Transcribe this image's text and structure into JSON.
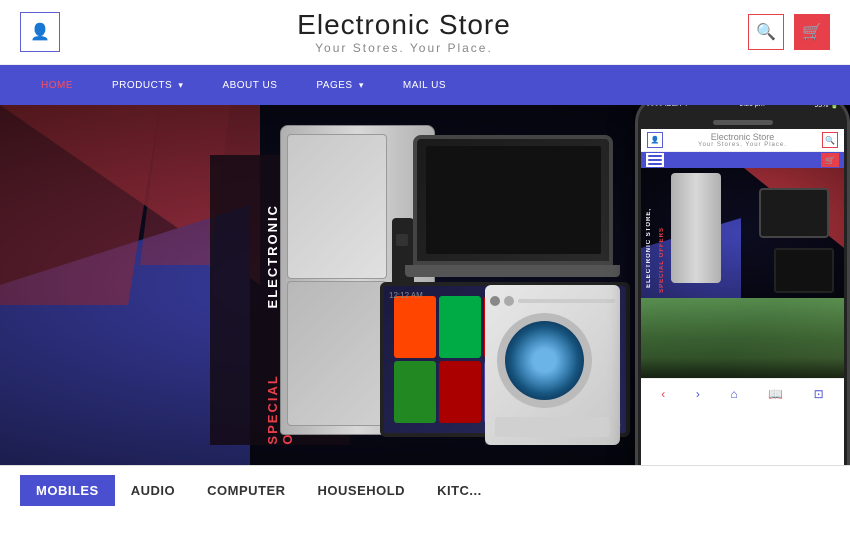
{
  "header": {
    "title": "Electronic Store",
    "subtitle": "Your Stores. Your Place.",
    "user_icon": "👤",
    "search_icon": "🔍",
    "cart_icon": "🛒"
  },
  "navbar": {
    "items": [
      {
        "label": "HOME",
        "active": true
      },
      {
        "label": "PRODUCTS ▾",
        "active": false
      },
      {
        "label": "ABOUT US",
        "active": false
      },
      {
        "label": "PAGES ▾",
        "active": false
      },
      {
        "label": "MAIL US",
        "active": false
      }
    ]
  },
  "hero": {
    "line1": "ELECTRONIC STORE,",
    "line2": "SPECIAL OFFERS"
  },
  "phone": {
    "title": "Electronic Store",
    "subtitle": "Your Stores. Your Place.",
    "hero_line1": "ELECTRONIC STORE,",
    "hero_line2": "SPECIAL OFFERS"
  },
  "categories": {
    "items": [
      {
        "label": "MOBILES",
        "active": true
      },
      {
        "label": "AUDIO",
        "active": false
      },
      {
        "label": "COMPUTER",
        "active": false
      },
      {
        "label": "HOUSEHOLD",
        "active": false
      },
      {
        "label": "KITC...",
        "active": false
      }
    ]
  }
}
